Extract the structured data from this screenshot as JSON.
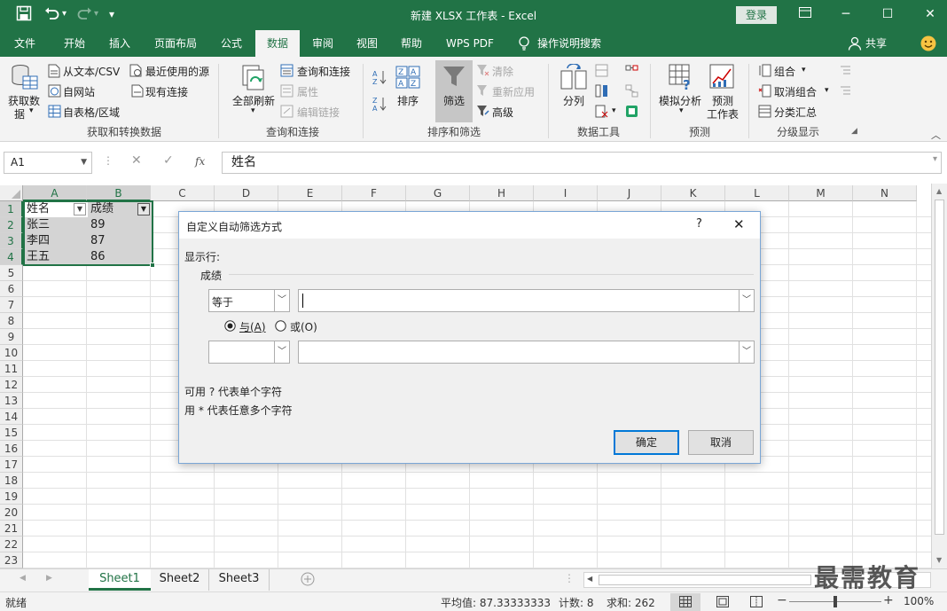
{
  "titlebar": {
    "title": "新建 XLSX 工作表  -  Excel",
    "login": "登录"
  },
  "tabs": [
    "文件",
    "开始",
    "插入",
    "页面布局",
    "公式",
    "数据",
    "审阅",
    "视图",
    "帮助",
    "WPS PDF",
    "操作说明搜索",
    "共享"
  ],
  "ribbon": {
    "get_data": [
      "获取数",
      "据"
    ],
    "from_text_csv": "从文本/CSV",
    "from_web": "自网站",
    "from_table": "自表格/区域",
    "recent_sources": "最近使用的源",
    "existing_connections": "现有连接",
    "group1": "获取和转换数据",
    "refresh_all": "全部刷新",
    "queries_connections": "查询和连接",
    "properties": "属性",
    "edit_links": "编辑链接",
    "group2": "查询和连接",
    "sort": "排序",
    "filter": "筛选",
    "clear": "清除",
    "reapply": "重新应用",
    "advanced": "高级",
    "group3": "排序和筛选",
    "text_to_columns": "分列",
    "group4": "数据工具",
    "whatif": "模拟分析",
    "forecast_sheet": [
      "预测",
      "工作表"
    ],
    "group5": "预测",
    "group_btn": "组合",
    "ungroup_btn": "取消组合",
    "subtotal": "分类汇总",
    "group6": "分级显示"
  },
  "formula_bar": {
    "name_box": "A1",
    "fx": "fx",
    "content": "姓名"
  },
  "grid": {
    "columns": [
      "A",
      "B",
      "C",
      "D",
      "E",
      "F",
      "G",
      "H",
      "I",
      "J",
      "K",
      "L",
      "M",
      "N"
    ],
    "rows": [
      "1",
      "2",
      "3",
      "4",
      "5",
      "6",
      "7",
      "8",
      "9",
      "10",
      "11",
      "12",
      "13",
      "14",
      "15",
      "16",
      "17",
      "18",
      "19",
      "20",
      "21",
      "22",
      "23"
    ],
    "cells": [
      {
        "a": "姓名",
        "b": "成绩"
      },
      {
        "a": "张三",
        "b": "89"
      },
      {
        "a": "李四",
        "b": "87"
      },
      {
        "a": "王五",
        "b": "86"
      }
    ]
  },
  "dialog": {
    "title": "自定义自动筛选方式",
    "help": "?",
    "show_rows": "显示行:",
    "field": "成绩",
    "op1": "等于",
    "value1": "",
    "and_label": "与(A)",
    "or_label": "或(O)",
    "op2": "",
    "value2": "",
    "hint1": "可用 ? 代表单个字符",
    "hint2": "用 * 代表任意多个字符",
    "ok": "确定",
    "cancel": "取消"
  },
  "sheets": [
    "Sheet1",
    "Sheet2",
    "Sheet3"
  ],
  "status": {
    "ready": "就绪",
    "average": "平均值: 87.33333333",
    "count": "计数: 8",
    "sum": "求和: 262",
    "zoom": "100%"
  },
  "watermark": "最需教育",
  "colors": {
    "accent": "#217346",
    "dialog_border": "#7aa6d6",
    "button_focus": "#0078d7"
  }
}
